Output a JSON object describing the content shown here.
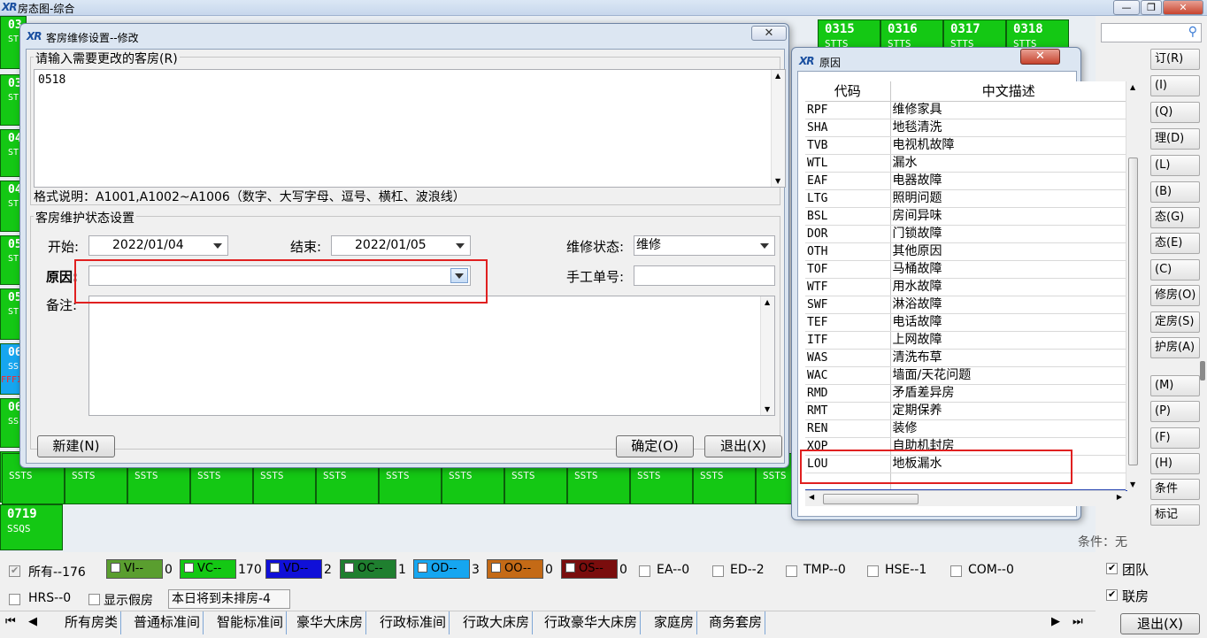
{
  "app": {
    "title": "房态图-综合",
    "logo": "XR"
  },
  "window_controls": {
    "minimize": "—",
    "restore": "❐",
    "close": "✕"
  },
  "grid": {
    "left_rooms": [
      "03",
      "03",
      "04",
      "04",
      "05",
      "05",
      "06",
      "06",
      "07"
    ],
    "left_sub": [
      "ST",
      "ST",
      "ST",
      "ST",
      "ST",
      "ST",
      "SS",
      "SS",
      "SS"
    ],
    "left_extra": "FFFI",
    "top_rooms": [
      {
        "number": "0315",
        "type": "STTS"
      },
      {
        "number": "0316",
        "type": "STTS"
      },
      {
        "number": "0317",
        "type": "STTS"
      },
      {
        "number": "0318",
        "type": "STTS"
      }
    ],
    "row7_types": [
      "SSTS",
      "SSTS",
      "SSTS",
      "SSTS",
      "SSTS",
      "SSTS",
      "SSTS",
      "SSTS",
      "SSTS",
      "SSTS",
      "SSTS",
      "SSTS",
      "SSTS"
    ],
    "bottom_room": {
      "number": "0719",
      "type": "SSQS"
    }
  },
  "right_panel": {
    "search_placeholder": "",
    "buttons": [
      "订(R)",
      "(I)",
      "(Q)",
      "理(D)",
      "(L)",
      "(B)",
      "态(G)",
      "态(E)",
      "(C)",
      "修房(O)",
      "定房(S)",
      "护房(A)",
      "(M)",
      "(P)",
      "(F)",
      "(H)",
      "条件",
      "标记"
    ],
    "condition_label": "条件：无",
    "team_label": "团队",
    "linked_label": "联房",
    "exit_label": "退出(X)"
  },
  "legend": {
    "all_label": "所有--176",
    "swatches": [
      {
        "label": "VI--",
        "count": "0",
        "color": "#5a9e2f"
      },
      {
        "label": "VC--",
        "count": "170",
        "color": "#14c814"
      },
      {
        "label": "VD--",
        "count": "2",
        "color": "#1010d8"
      },
      {
        "label": "OC--",
        "count": "1",
        "color": "#1f7f2f"
      },
      {
        "label": "OD--",
        "count": "3",
        "color": "#16a6f0"
      },
      {
        "label": "OO--",
        "count": "0",
        "color": "#c46a16"
      },
      {
        "label": "OS--",
        "count": "0",
        "color": "#7a0d0d"
      }
    ],
    "checks": [
      "EA--0",
      "ED--2",
      "TMP--0",
      "HSE--1",
      "COM--0"
    ],
    "hrs": "HRS--0",
    "show_fake": "显示假房",
    "today_arrivals": "本日将到未排房-4"
  },
  "tabs": [
    "所有房类",
    "普通标准间",
    "智能标准间",
    "豪华大床房",
    "行政标准间",
    "行政大床房",
    "行政豪华大床房",
    "家庭房",
    "商务套房"
  ],
  "dialog_main": {
    "title": "客房维修设置--修改",
    "rooms_group": "请输入需要更改的客房(R)",
    "rooms_value": "0518",
    "format_hint": "格式说明：A1001,A1002~A1006（数字、大写字母、逗号、横杠、波浪线）",
    "status_group": "客房维护状态设置",
    "start_label": "开始:",
    "start_value": "2022/01/04",
    "end_label": "结束:",
    "end_value": "2022/01/05",
    "repair_status_label": "维修状态:",
    "repair_status_value": "维修",
    "reason_label": "原因:",
    "reason_value": "",
    "manual_no_label": "手工单号:",
    "manual_no_value": "",
    "remark_label": "备注:",
    "new_button": "新建(N)",
    "ok_button": "确定(O)",
    "exit_button": "退出(X)"
  },
  "dialog_reason": {
    "title": "原因",
    "col_code": "代码",
    "col_desc": "中文描述",
    "rows": [
      {
        "code": "RPF",
        "desc": "维修家具"
      },
      {
        "code": "SHA",
        "desc": "地毯清洗"
      },
      {
        "code": "TVB",
        "desc": "电视机故障"
      },
      {
        "code": "WTL",
        "desc": "漏水"
      },
      {
        "code": "EAF",
        "desc": "电器故障"
      },
      {
        "code": "LTG",
        "desc": "照明问题"
      },
      {
        "code": "BSL",
        "desc": "房间异味"
      },
      {
        "code": "DOR",
        "desc": "门锁故障"
      },
      {
        "code": "OTH",
        "desc": "其他原因"
      },
      {
        "code": "TOF",
        "desc": "马桶故障"
      },
      {
        "code": "WTF",
        "desc": "用水故障"
      },
      {
        "code": "SWF",
        "desc": "淋浴故障"
      },
      {
        "code": "TEF",
        "desc": "电话故障"
      },
      {
        "code": "ITF",
        "desc": "上网故障"
      },
      {
        "code": "WAS",
        "desc": "清洗布草"
      },
      {
        "code": "WAC",
        "desc": "墙面/天花问题"
      },
      {
        "code": "RMD",
        "desc": "矛盾差异房"
      },
      {
        "code": "RMT",
        "desc": "定期保养"
      },
      {
        "code": "REN",
        "desc": "装修"
      },
      {
        "code": "XOP",
        "desc": "自助机封房"
      },
      {
        "code": "LOU",
        "desc": "地板漏水"
      }
    ]
  }
}
